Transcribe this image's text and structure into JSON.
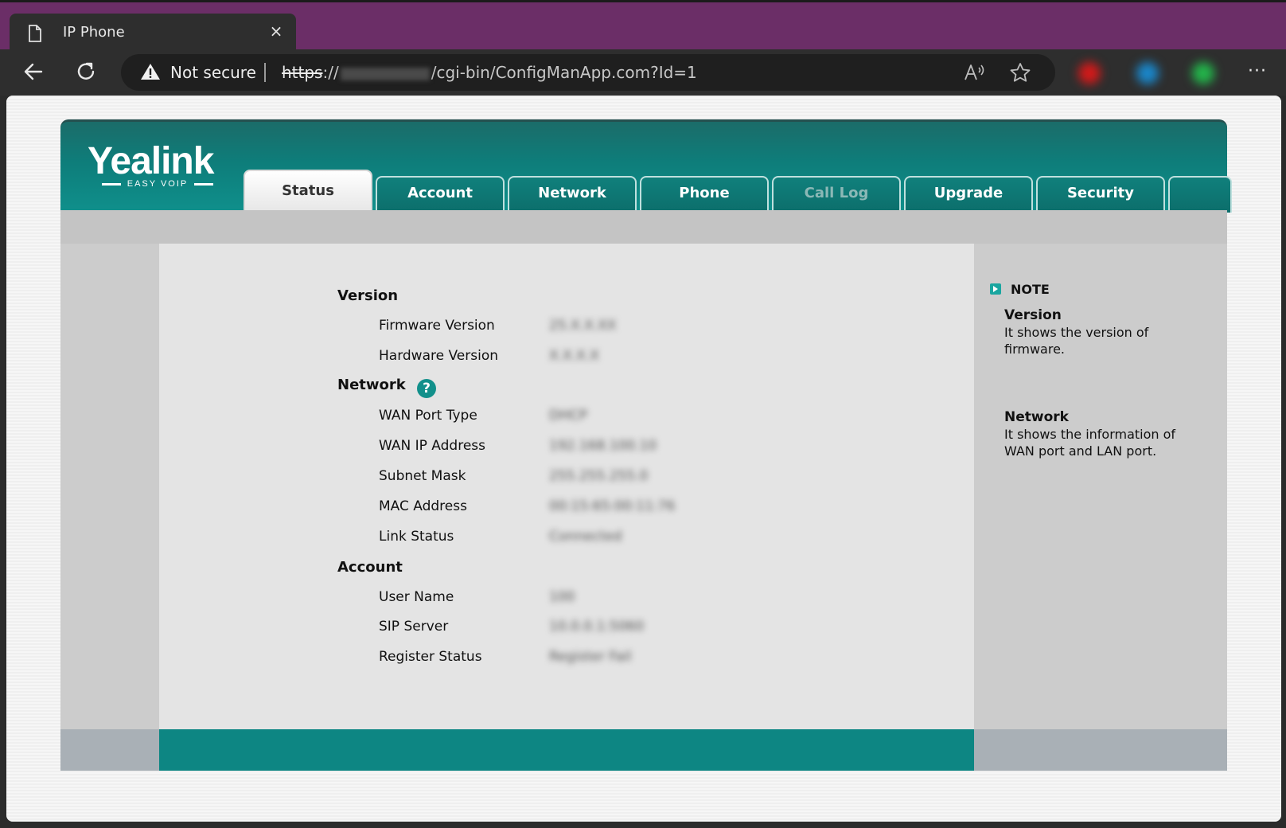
{
  "browser": {
    "tab_title": "IP Phone",
    "tab_close": "×",
    "security_text": "Not secure",
    "url_scheme": "https",
    "url_sep": "://",
    "url_path": "/cgi-bin/ConfigManApp.com?Id=1",
    "more_label": "···",
    "extension_colors": [
      "#d11a1a",
      "#1a86c9",
      "#23b34a"
    ]
  },
  "header": {
    "logo": "Yealink",
    "logo_tagline": "EASY VOIP"
  },
  "nav": {
    "tabs": [
      {
        "label": "Status",
        "active": true
      },
      {
        "label": "Account"
      },
      {
        "label": "Network"
      },
      {
        "label": "Phone"
      },
      {
        "label": "Call Log",
        "disabled": true
      },
      {
        "label": "Upgrade"
      },
      {
        "label": "Security"
      }
    ]
  },
  "status": {
    "version": {
      "title": "Version",
      "firmware_label": "Firmware Version",
      "firmware_value": "25.X.X.XX",
      "hardware_label": "Hardware Version",
      "hardware_value": "X.X.X.X"
    },
    "network": {
      "title": "Network",
      "help": "?",
      "wan_type_label": "WAN Port Type",
      "wan_type_value": "DHCP",
      "wan_ip_label": "WAN IP Address",
      "wan_ip_value": "192.168.100.10",
      "subnet_label": "Subnet Mask",
      "subnet_value": "255.255.255.0",
      "mac_label": "MAC Address",
      "mac_value": "00:15:65:00:11:76",
      "link_label": "Link Status",
      "link_value": "Connected"
    },
    "account": {
      "title": "Account",
      "user_label": "User Name",
      "user_value": "100",
      "sip_label": "SIP Server",
      "sip_value": "10.0.0.1:5060",
      "register_label": "Register Status",
      "register_value": "Register Fail"
    }
  },
  "note": {
    "header": "NOTE",
    "version_title": "Version",
    "version_text": "It shows the version of firmware.",
    "network_title": "Network",
    "network_text": "It shows the information of WAN port and LAN port."
  },
  "colors": {
    "brand_teal": "#0d8683",
    "titlebar": "#6b2e67"
  }
}
